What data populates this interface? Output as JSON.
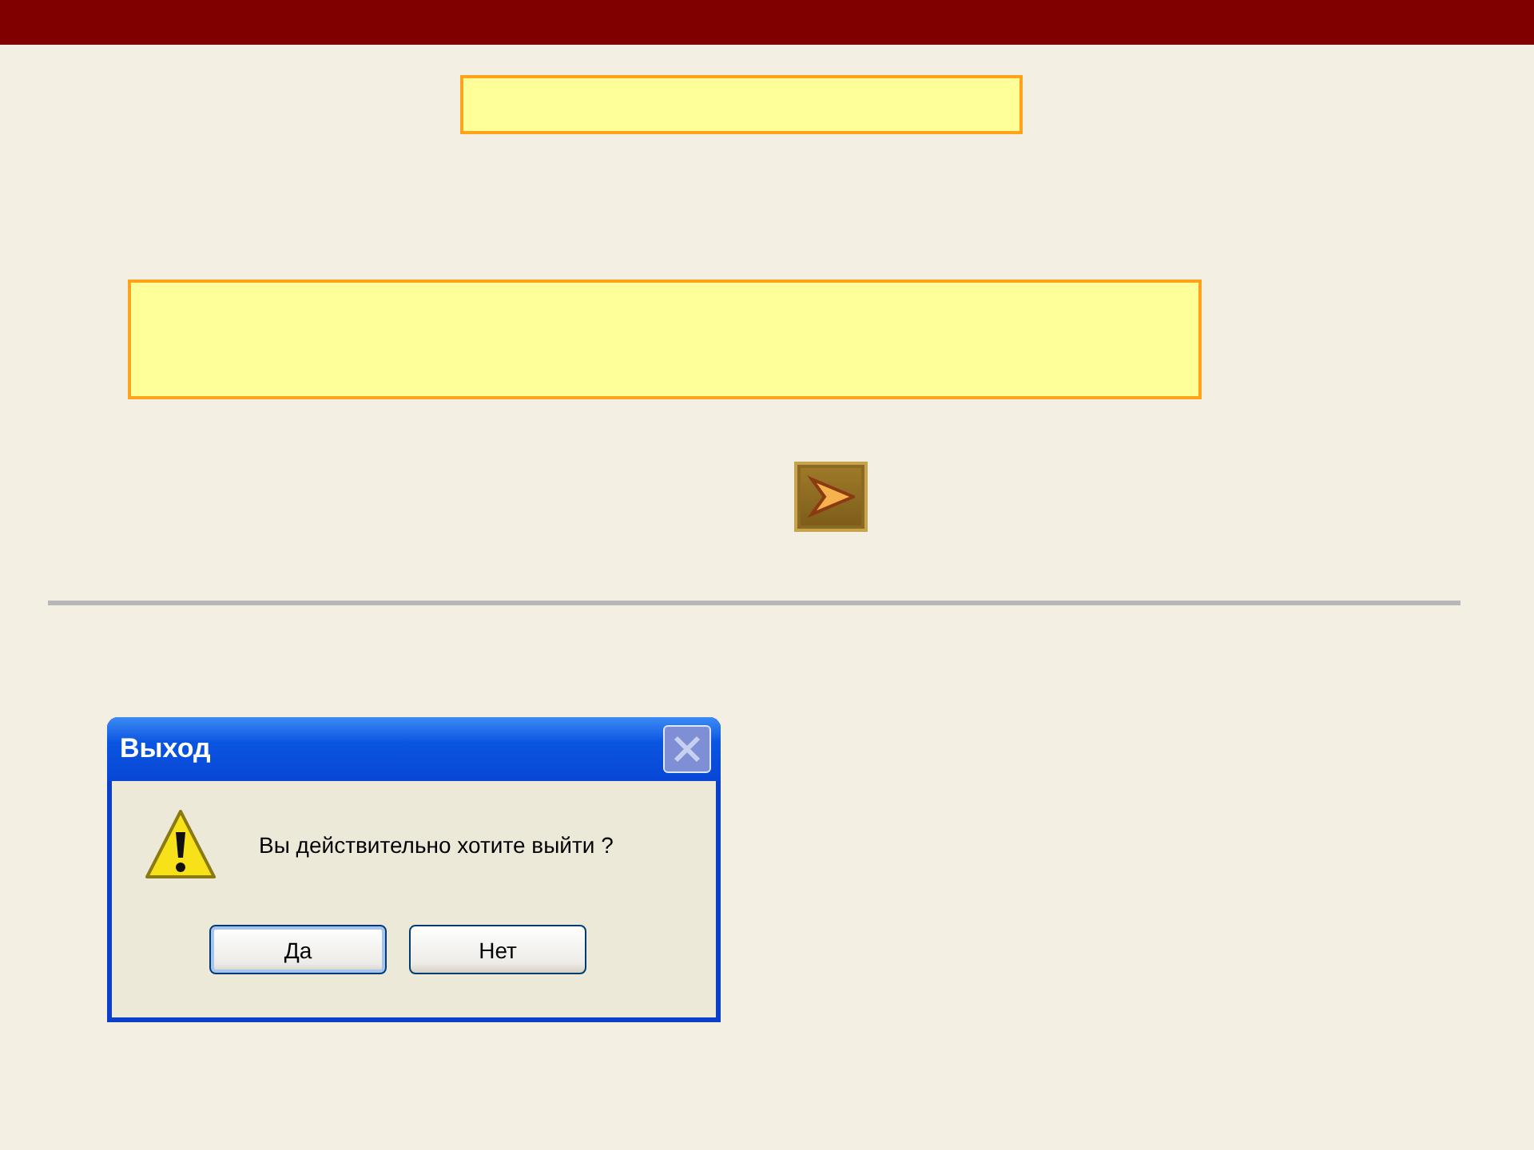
{
  "dialog": {
    "title": "Выход",
    "message": "Вы действительно хотите выйти ?",
    "buttons": [
      {
        "label": "Да",
        "selected": true
      },
      {
        "label": "Нет",
        "selected": false
      }
    ]
  }
}
